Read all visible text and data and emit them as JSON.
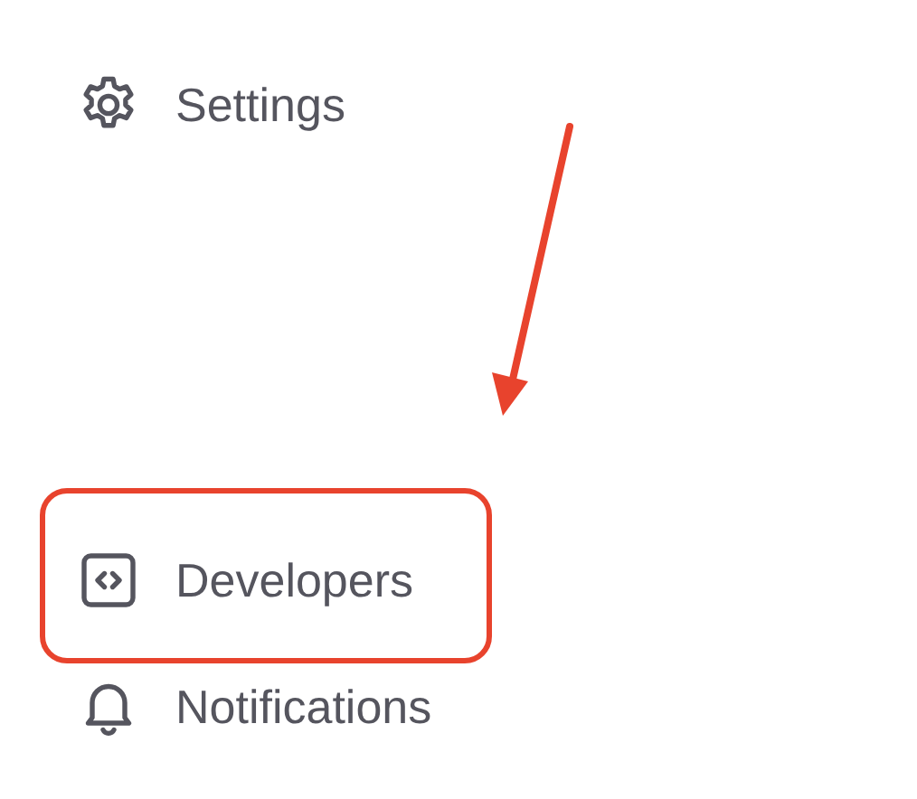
{
  "sidebar": {
    "items": [
      {
        "label": "Settings",
        "highlighted": false
      },
      {
        "label": "Developers",
        "highlighted": true
      },
      {
        "label": "Notifications",
        "highlighted": false
      }
    ]
  }
}
